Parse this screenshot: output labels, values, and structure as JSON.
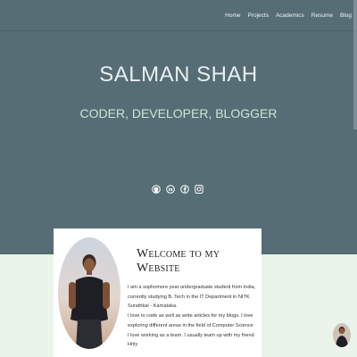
{
  "nav": {
    "items": [
      "Home",
      "Projects",
      "Academics",
      "Resume",
      "Blog"
    ]
  },
  "hero": {
    "name": "SALMAN SHAH",
    "tagline": "CODER, DEVELOPER, BLOGGER",
    "socials": [
      "github-icon",
      "linkedin-icon",
      "facebook-icon",
      "instagram-icon"
    ]
  },
  "colors": {
    "hero_bg": "#566d76",
    "page_bg": "#eaf4ea",
    "tagline": "#cfe5d8"
  },
  "card": {
    "title": "Welcome to my Website",
    "lines": [
      "I am a sophomore year undergraduate student from India,",
      "currently studying B. Tech in the IT Department in NITK",
      "Surathkal - Karnataka.",
      "I love to code as well as write articles for my blogs. I love",
      "exploring different areas in the field of Computer Science",
      "I love working as a team. I usually team up with my friend Hriiy"
    ]
  }
}
